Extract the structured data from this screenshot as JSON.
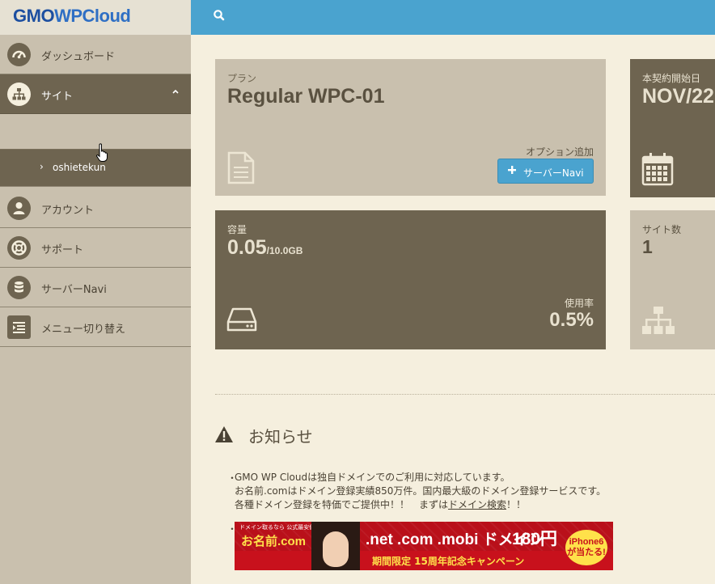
{
  "header": {
    "logo_left": "GMO",
    "logo_right": "WPCloud",
    "search_icon": "search-icon",
    "bar_color": "#4aa3cf"
  },
  "sidebar": {
    "items": [
      {
        "label": "ダッシュボード",
        "icon": "dashboard-gauge-icon"
      },
      {
        "label": "サイト",
        "icon": "sitemap-icon",
        "active": true
      },
      {
        "label": "アカウント",
        "icon": "user-icon"
      },
      {
        "label": "サポート",
        "icon": "lifebuoy-icon"
      },
      {
        "label": "サーバーNavi",
        "icon": "database-icon"
      },
      {
        "label": "メニュー切り替え",
        "icon": "menu-toggle-icon"
      }
    ],
    "subitem": {
      "label": "oshietekun"
    },
    "active_color": "#6e6450"
  },
  "cards": {
    "plan": {
      "caption": "プラン",
      "value": "Regular WPC-01",
      "option_label": "オプション追加",
      "button_label": "サーバーNavi"
    },
    "contract": {
      "caption": "本契約開始日",
      "value": "NOV/22"
    },
    "capacity": {
      "caption": "容量",
      "value": "0.05",
      "unit": "/10.0GB",
      "usage_caption": "使用率",
      "usage_value": "0.5%"
    },
    "sites": {
      "caption": "サイト数",
      "value": "1"
    }
  },
  "notice": {
    "title": "お知らせ",
    "bullet": "・",
    "line1": "GMO WP Cloudは独自ドメインでのご利用に対応しています。",
    "line2": "お名前.comはドメイン登録実績850万件。国内最大級のドメイン登録サービスです。",
    "line3_pre": "各種ドメイン登録を特価でご提供中！！　まずは",
    "line3_link": "ドメイン検索",
    "line3_post": "！！"
  },
  "banner": {
    "top_note": "ドメイン取るなら 公式最安値！",
    "logo": "お名前.com",
    "tlds": ".net .com .mobi ドメイン",
    "price": "180円",
    "campaign": "期間限定 15周年記念キャンペーン",
    "badge_line1": "iPhone6",
    "badge_line2": "が当たる!"
  }
}
